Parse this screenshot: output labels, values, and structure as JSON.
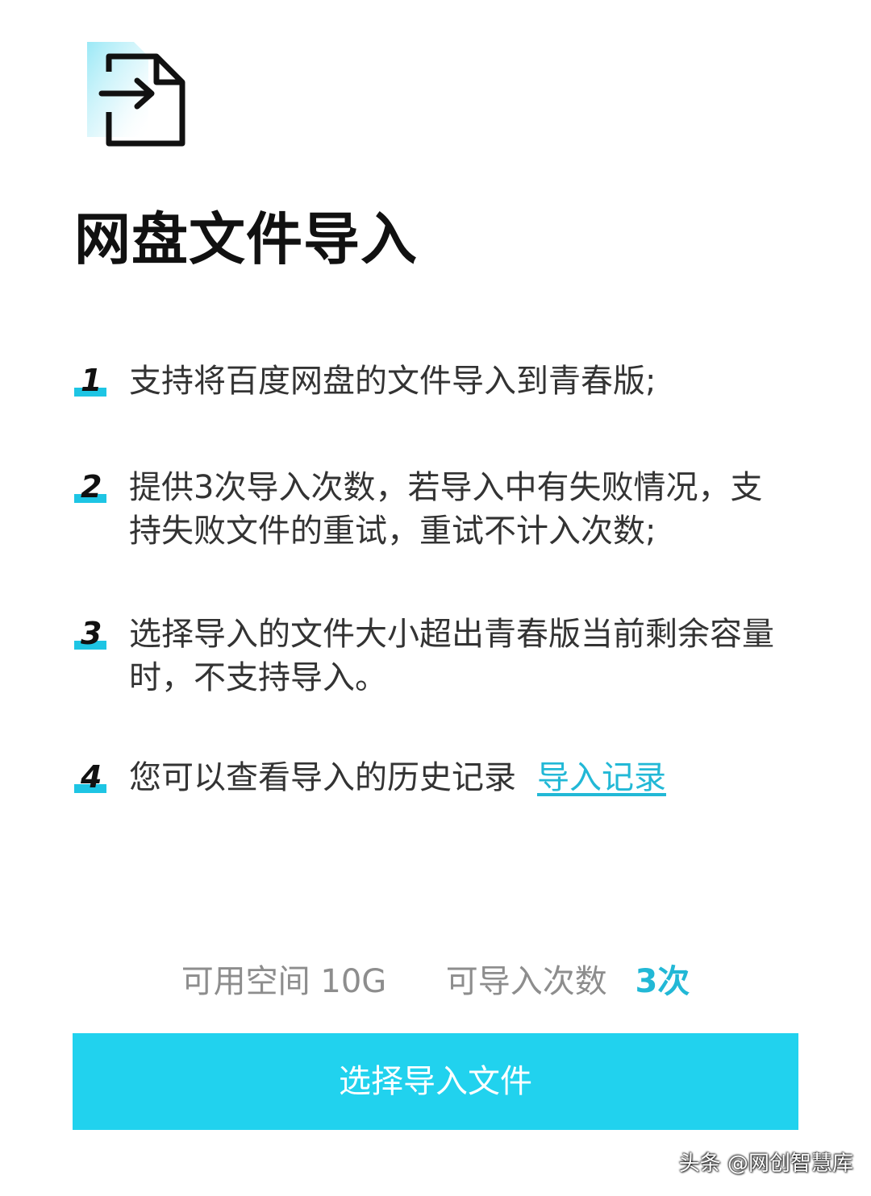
{
  "header": {
    "icon": "file-import-icon",
    "title": "网盘文件导入"
  },
  "rules": [
    {
      "number": "1",
      "text": "支持将百度网盘的文件导入到青春版;"
    },
    {
      "number": "2",
      "text": "提供3次导入次数，若导入中有失败情况，支持失败文件的重试，重试不计入次数;"
    },
    {
      "number": "3",
      "text": "选择导入的文件大小超出青春版当前剩余容量时，不支持导入。"
    },
    {
      "number": "4",
      "text": "您可以查看导入的历史记录",
      "link_label": "导入记录"
    }
  ],
  "quota": {
    "space_label": "可用空间",
    "space_value": "10G",
    "count_label": "可导入次数",
    "count_value": "3次"
  },
  "action": {
    "button_label": "选择导入文件"
  },
  "watermark": "头条 @网创智慧库",
  "colors": {
    "accent": "#21d2ee",
    "link": "#22b8d6",
    "number_bar": "#1ec5e4",
    "title": "#111111",
    "body_text": "#333333",
    "muted_text": "#8d8d8d",
    "background": "#ffffff"
  }
}
